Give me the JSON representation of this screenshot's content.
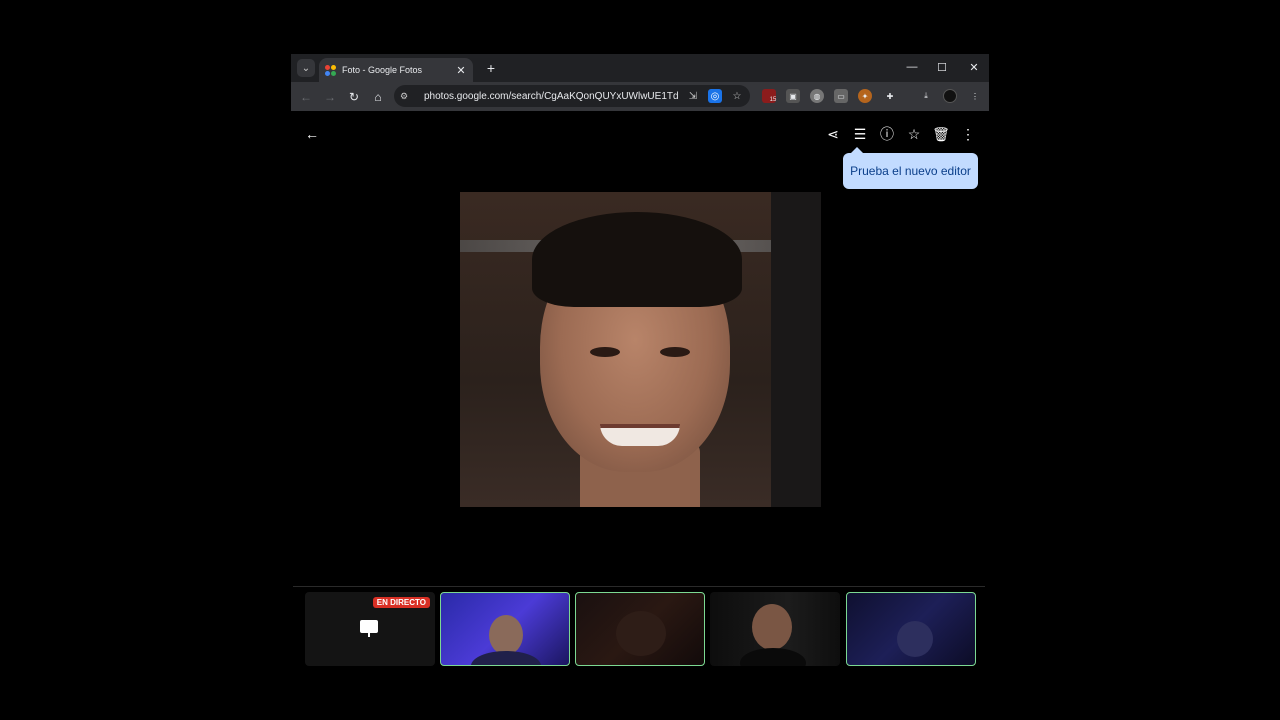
{
  "browser": {
    "tab": {
      "title": "Foto - Google Fotos",
      "close_glyph": "✕"
    },
    "new_tab_glyph": "+",
    "omnibox": {
      "url": "photos.google.com/search/CgAaKQonQUYxUWlwUE1TdW1..."
    },
    "window_controls": {
      "minimize": "—",
      "maximize": "☐",
      "close": "✕"
    },
    "extensions": [
      {
        "name": "extension-red-badge",
        "badge": "15"
      }
    ]
  },
  "photo_viewer": {
    "tooltip": "Prueba el nuevo editor"
  },
  "participants": {
    "live_badge": "EN DIRECTO"
  },
  "colors": {
    "tooltip_bg": "#c2dbff",
    "tooltip_text": "#0b3f8a",
    "live_badge": "#d93025",
    "active_speaker_border": "#7cd992"
  }
}
